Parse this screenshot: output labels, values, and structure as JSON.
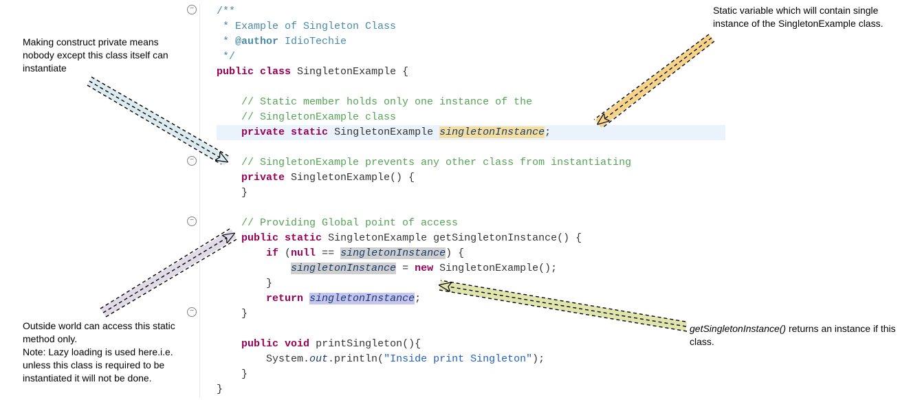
{
  "annotations": {
    "a1": "Making construct private means nobody except this class itself can instantiate",
    "a2_l1": "Outside world can access this static method only.",
    "a2_l2": "Note: Lazy loading is used here.i.e. unless this class is required to be instantiated it will not be done.",
    "a3": "Static variable which will contain single instance of the SingletonExample class.",
    "a4_it": "getSingletonInstance()",
    "a4_rest": " returns an instance if this class."
  },
  "code": {
    "l1": "/**",
    "l2": " * Example of Singleton Class",
    "l3_a": " * ",
    "l3_tag": "@author",
    "l3_b": " IdioTechie",
    "l4": " */",
    "l5_a": "public",
    "l5_b": "class",
    "l5_c": " SingletonExample {",
    "l7": "    // Static member holds only one instance of the",
    "l8": "    // SingletonExample class",
    "l9_a": "private",
    "l9_b": "static",
    "l9_c": " SingletonExample ",
    "l9_d": "singletonInstance",
    "l9_e": ";",
    "l11": "    // SingletonExample prevents any other class from instantiating",
    "l12_a": "private",
    "l12_b": " SingletonExample() {",
    "l13": "    }",
    "l15": "    // Providing Global point of access",
    "l16_a": "public",
    "l16_b": "static",
    "l16_c": " SingletonExample getSingletonInstance() {",
    "l17_a": "if",
    "l17_b": " (",
    "l17_c": "null",
    "l17_d": " == ",
    "l17_e": "singletonInstance",
    "l17_f": ") {",
    "l18_a": "singletonInstance",
    "l18_b": " = ",
    "l18_c": "new",
    "l18_d": " SingletonExample();",
    "l19": "        }",
    "l20_a": "return",
    "l20_b": " ",
    "l20_c": "singletonInstance",
    "l20_d": ";",
    "l21": "    }",
    "l23_a": "public",
    "l23_b": "void",
    "l23_c": " printSingleton(){",
    "l24_a": "        System.",
    "l24_b": "out",
    "l24_c": ".println(",
    "l24_d": "\"Inside print Singleton\"",
    "l24_e": ");",
    "l25": "    }",
    "l26": "}"
  },
  "fold_glyph": "−"
}
